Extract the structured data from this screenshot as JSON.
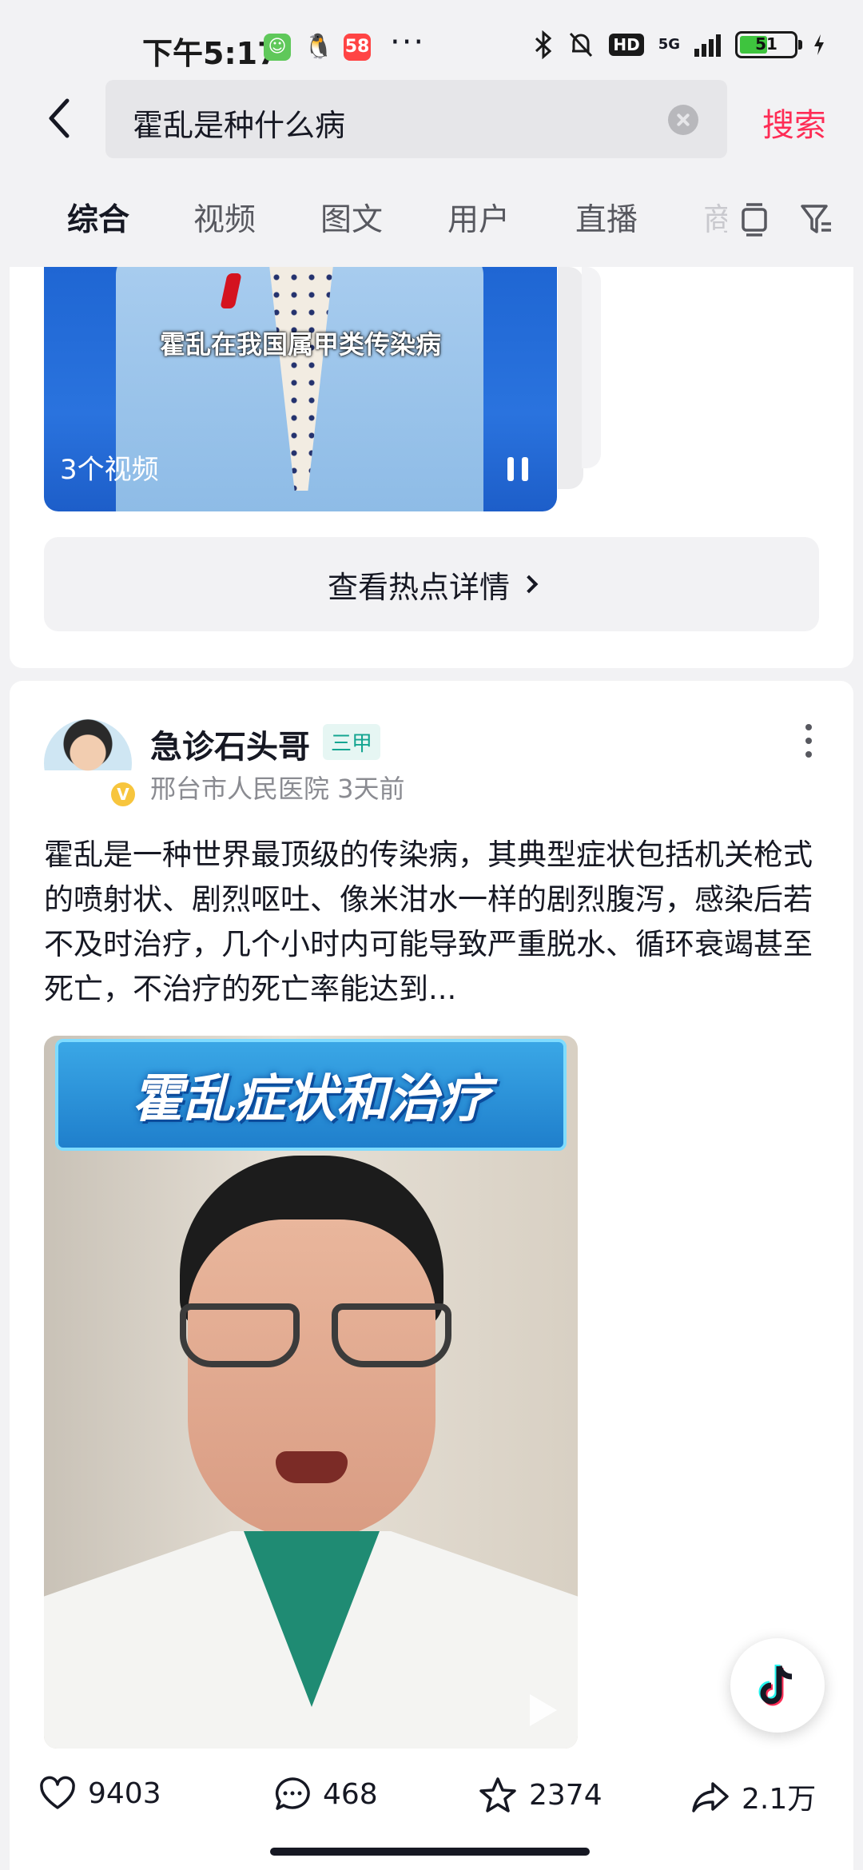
{
  "status_bar": {
    "time": "下午5:17",
    "app_58_label": "58",
    "more": "···",
    "hd": "HD",
    "network": "5G",
    "battery": "51",
    "battery_level": 0.51
  },
  "search": {
    "query": "霍乱是种什么病",
    "submit_label": "搜索"
  },
  "tabs": [
    {
      "label": "综合",
      "active": true
    },
    {
      "label": "视频"
    },
    {
      "label": "图文"
    },
    {
      "label": "用户"
    },
    {
      "label": "直播"
    },
    {
      "label": "商"
    }
  ],
  "hot_topic": {
    "video_subtitle": "霍乱在我国属甲类传染病",
    "video_count": "3个视频",
    "detail_button": "查看热点详情"
  },
  "post": {
    "author": "急诊石头哥",
    "badge": "三甲",
    "verified_mark": "V",
    "meta": "邢台市人民医院 3天前",
    "text": "霍乱是一种世界最顶级的传染病，其典型症状包括机关枪式的喷射状、剧烈呕吐、像米泔水一样的剧烈腹泻，感染后若不及时治疗，几个小时内可能导致严重脱水、循环衰竭甚至死亡，不治疗的死亡率能达到...",
    "video_banner": "霍乱症状和治疗",
    "likes": "9403",
    "comments": "468",
    "favorites": "2374",
    "shares": "2.1万"
  },
  "colors": {
    "accent": "#fe2c55",
    "badge_green": "#15a591",
    "background": "#f2f2f4"
  }
}
